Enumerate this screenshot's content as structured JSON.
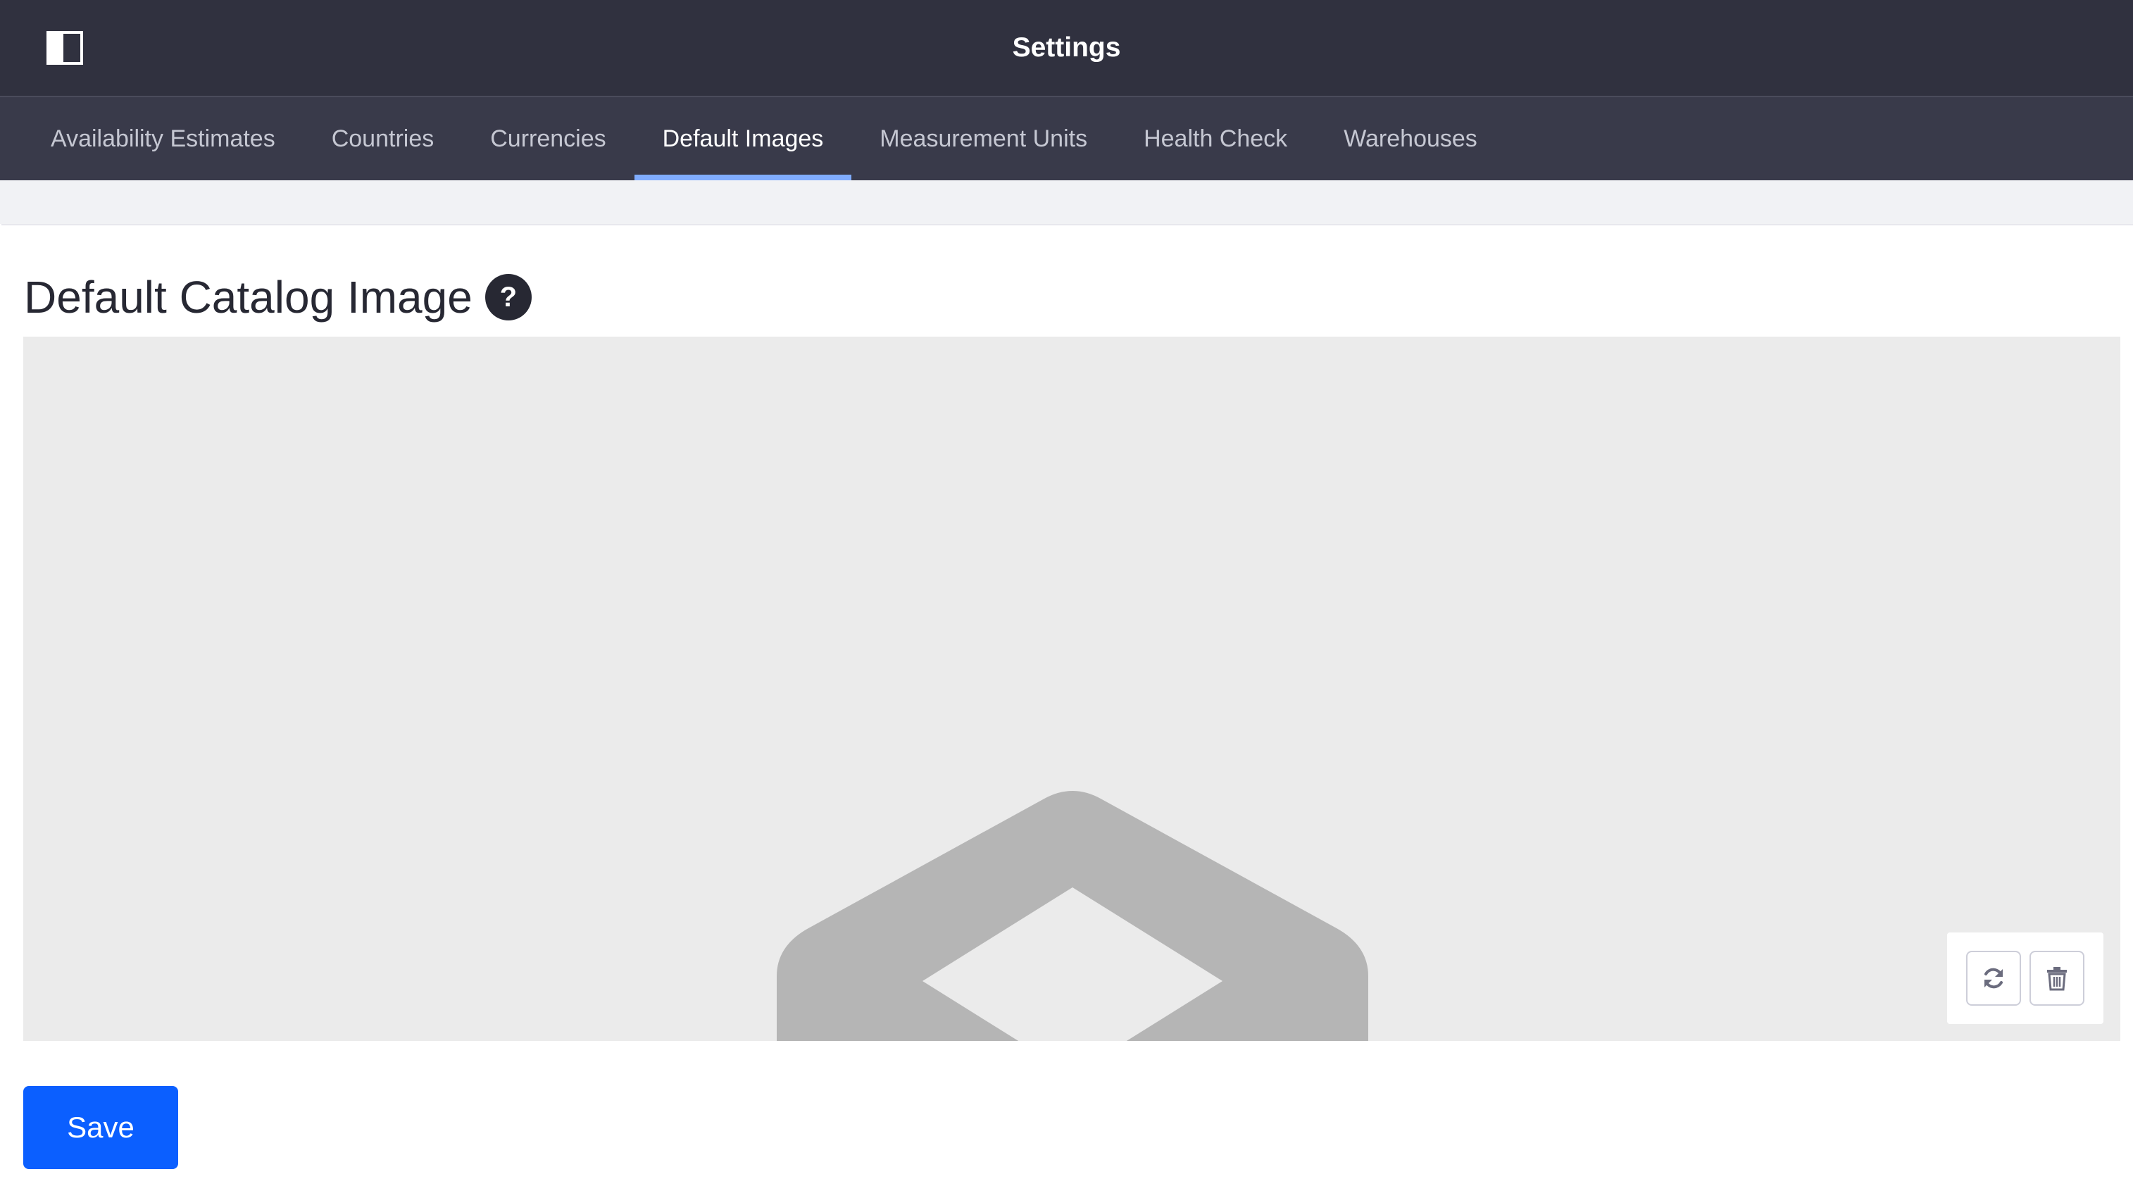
{
  "header": {
    "title": "Settings",
    "sidebar_toggle_icon": "sidebar-toggle-icon"
  },
  "tabs": [
    {
      "label": "Availability Estimates",
      "active": false
    },
    {
      "label": "Countries",
      "active": false
    },
    {
      "label": "Currencies",
      "active": false
    },
    {
      "label": "Default Images",
      "active": true
    },
    {
      "label": "Measurement Units",
      "active": false
    },
    {
      "label": "Health Check",
      "active": false
    },
    {
      "label": "Warehouses",
      "active": false
    }
  ],
  "section": {
    "title": "Default Catalog Image",
    "help_icon_glyph": "?"
  },
  "image_preview": {
    "placeholder_icon": "image-placeholder-icon",
    "actions": [
      {
        "name": "change-image-button",
        "icon": "refresh-icon"
      },
      {
        "name": "delete-image-button",
        "icon": "trash-icon"
      }
    ]
  },
  "footer": {
    "save_label": "Save"
  },
  "colors": {
    "header_bg": "#30313f",
    "nav_bg": "#393a4a",
    "active_tab_indicator": "#80acff",
    "primary_button": "#0b5fff",
    "preview_bg": "#ebebeb",
    "placeholder_gray": "#b5b5b5"
  }
}
